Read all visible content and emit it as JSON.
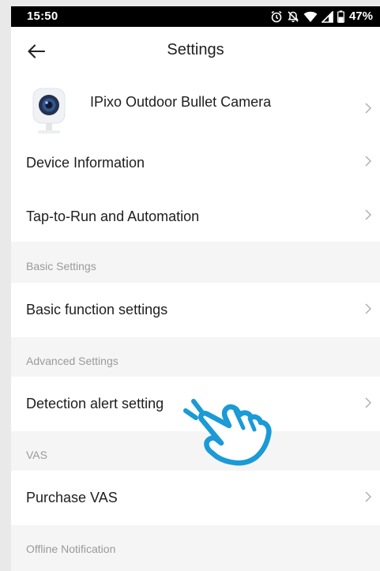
{
  "status_bar": {
    "time": "15:50",
    "battery": "47%",
    "icons": [
      "alarm-icon",
      "notifications-off-icon",
      "wifi-icon",
      "signal-icon",
      "battery-icon"
    ]
  },
  "app_bar": {
    "title": "Settings",
    "back_icon": "arrow-left-icon"
  },
  "device": {
    "name": "IPixo Outdoor Bullet Camera",
    "icon": "camera-icon"
  },
  "items": [
    {
      "label": "Device Information"
    },
    {
      "label": "Tap-to-Run and Automation"
    }
  ],
  "sections": [
    {
      "title": "Basic Settings",
      "items": [
        {
          "label": "Basic function settings"
        }
      ]
    },
    {
      "title": "Advanced Settings",
      "items": [
        {
          "label": "Detection alert setting"
        }
      ]
    },
    {
      "title": "VAS",
      "items": [
        {
          "label": "Purchase VAS"
        }
      ]
    },
    {
      "title": "Offline Notification",
      "items": []
    }
  ],
  "overlay": {
    "icon": "tap-hand-icon",
    "color": "#1a9ad6"
  },
  "colors": {
    "section_bg": "#f5f5f5",
    "text": "#1e1e1e",
    "muted": "#9a9a9a",
    "chevron": "#b0b0b0"
  }
}
